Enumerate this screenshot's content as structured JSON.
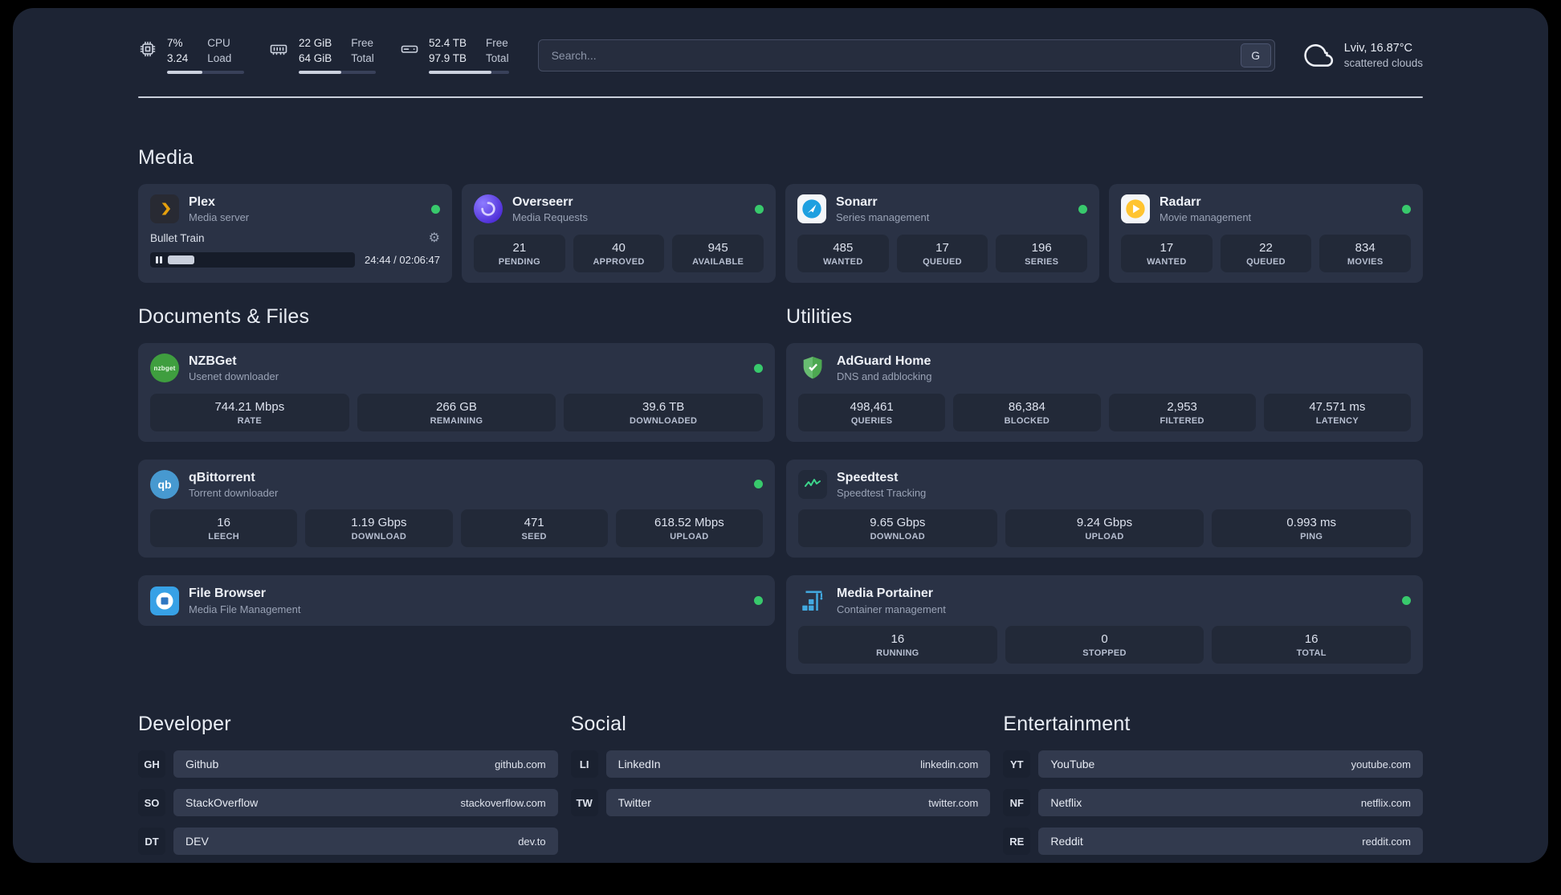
{
  "colors": {
    "page_background": "#1d2434",
    "card_background": "#2a3245",
    "status_online_green": "#38c96c",
    "plex_amber": "#e5a00d",
    "divider_light": "#c9cfdb"
  },
  "header": {
    "cpu": {
      "percent": "7%",
      "load": "3.24",
      "label_top": "CPU",
      "label_bottom": "Load"
    },
    "ram": {
      "free": "22 GiB",
      "total": "64 GiB",
      "label_top": "Free",
      "label_bottom": "Total"
    },
    "disk": {
      "free": "52.4 TB",
      "total": "97.9 TB",
      "label_top": "Free",
      "label_bottom": "Total"
    },
    "search": {
      "placeholder": "Search...",
      "button_label": "G"
    },
    "weather": {
      "location": "Lviv, 16.87°C",
      "condition": "scattered clouds"
    }
  },
  "media": {
    "title": "Media",
    "plex": {
      "name": "Plex",
      "subtitle": "Media server",
      "now_playing": "Bullet Train",
      "time": "24:44 / 02:06:47"
    },
    "overseerr": {
      "name": "Overseerr",
      "subtitle": "Media Requests",
      "stats": [
        {
          "value": "21",
          "label": "PENDING"
        },
        {
          "value": "40",
          "label": "APPROVED"
        },
        {
          "value": "945",
          "label": "AVAILABLE"
        }
      ]
    },
    "sonarr": {
      "name": "Sonarr",
      "subtitle": "Series management",
      "stats": [
        {
          "value": "485",
          "label": "WANTED"
        },
        {
          "value": "17",
          "label": "QUEUED"
        },
        {
          "value": "196",
          "label": "SERIES"
        }
      ]
    },
    "radarr": {
      "name": "Radarr",
      "subtitle": "Movie management",
      "stats": [
        {
          "value": "17",
          "label": "WANTED"
        },
        {
          "value": "22",
          "label": "QUEUED"
        },
        {
          "value": "834",
          "label": "MOVIES"
        }
      ]
    }
  },
  "documents": {
    "title": "Documents & Files",
    "nzbget": {
      "name": "NZBGet",
      "subtitle": "Usenet downloader",
      "stats": [
        {
          "value": "744.21 Mbps",
          "label": "RATE"
        },
        {
          "value": "266 GB",
          "label": "REMAINING"
        },
        {
          "value": "39.6 TB",
          "label": "DOWNLOADED"
        }
      ]
    },
    "qbittorrent": {
      "name": "qBittorrent",
      "subtitle": "Torrent downloader",
      "stats": [
        {
          "value": "16",
          "label": "LEECH"
        },
        {
          "value": "1.19 Gbps",
          "label": "DOWNLOAD"
        },
        {
          "value": "471",
          "label": "SEED"
        },
        {
          "value": "618.52 Mbps",
          "label": "UPLOAD"
        }
      ]
    },
    "filebrowser": {
      "name": "File Browser",
      "subtitle": "Media File Management"
    }
  },
  "utilities": {
    "title": "Utilities",
    "adguard": {
      "name": "AdGuard Home",
      "subtitle": "DNS and adblocking",
      "stats": [
        {
          "value": "498,461",
          "label": "QUERIES"
        },
        {
          "value": "86,384",
          "label": "BLOCKED"
        },
        {
          "value": "2,953",
          "label": "FILTERED"
        },
        {
          "value": "47.571 ms",
          "label": "LATENCY"
        }
      ]
    },
    "speedtest": {
      "name": "Speedtest",
      "subtitle": "Speedtest Tracking",
      "stats": [
        {
          "value": "9.65 Gbps",
          "label": "DOWNLOAD"
        },
        {
          "value": "9.24 Gbps",
          "label": "UPLOAD"
        },
        {
          "value": "0.993 ms",
          "label": "PING"
        }
      ]
    },
    "portainer": {
      "name": "Media Portainer",
      "subtitle": "Container management",
      "stats": [
        {
          "value": "16",
          "label": "RUNNING"
        },
        {
          "value": "0",
          "label": "STOPPED"
        },
        {
          "value": "16",
          "label": "TOTAL"
        }
      ]
    }
  },
  "bookmarks": [
    {
      "title": "Developer",
      "items": [
        {
          "abbr": "GH",
          "name": "Github",
          "url": "github.com"
        },
        {
          "abbr": "SO",
          "name": "StackOverflow",
          "url": "stackoverflow.com"
        },
        {
          "abbr": "DT",
          "name": "DEV",
          "url": "dev.to"
        }
      ]
    },
    {
      "title": "Social",
      "items": [
        {
          "abbr": "LI",
          "name": "LinkedIn",
          "url": "linkedin.com"
        },
        {
          "abbr": "TW",
          "name": "Twitter",
          "url": "twitter.com"
        }
      ]
    },
    {
      "title": "Entertainment",
      "items": [
        {
          "abbr": "YT",
          "name": "YouTube",
          "url": "youtube.com"
        },
        {
          "abbr": "NF",
          "name": "Netflix",
          "url": "netflix.com"
        },
        {
          "abbr": "RE",
          "name": "Reddit",
          "url": "reddit.com"
        }
      ]
    }
  ],
  "icons": {
    "gear": "⚙",
    "nzbget_label": "nzbget",
    "qbittorrent_label": "qb"
  }
}
